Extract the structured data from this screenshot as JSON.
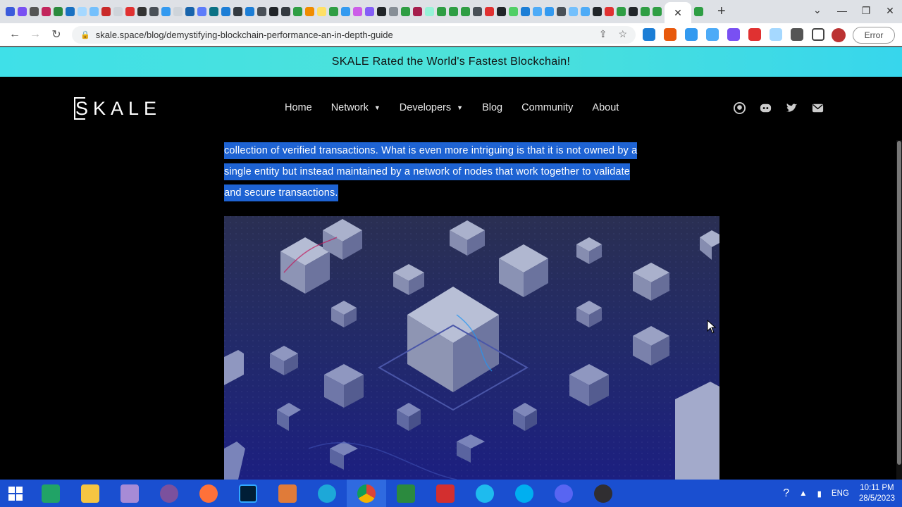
{
  "browser": {
    "url": "skale.space/blog/demystifying-blockchain-performance-an-in-depth-guide",
    "error_label": "Error",
    "active_tab_close": "✕",
    "new_tab": "+",
    "tab_menu": "⌄",
    "window_controls": [
      "—",
      "❐",
      "✕"
    ]
  },
  "announcement": "SKALE Rated the World's Fastest Blockchain!",
  "header": {
    "logo": "SKALE",
    "nav": [
      {
        "label": "Home",
        "has_dropdown": false
      },
      {
        "label": "Network",
        "has_dropdown": true
      },
      {
        "label": "Developers",
        "has_dropdown": true
      },
      {
        "label": "Blog",
        "has_dropdown": false
      },
      {
        "label": "Community",
        "has_dropdown": false
      },
      {
        "label": "About",
        "has_dropdown": false
      }
    ],
    "social_icons": [
      "github-icon",
      "discord-icon",
      "twitter-icon",
      "email-icon"
    ]
  },
  "article": {
    "lines": [
      "collection of verified transactions. What is even more intriguing is that it is not owned by a",
      "single entity but instead maintained by a network of nodes that work together to validate",
      "and secure transactions."
    ]
  },
  "taskbar": {
    "tray_language": "ENG",
    "time": "10:11 PM",
    "date": "28/5/2023"
  },
  "colors": {
    "announcement_bg": "#3fe0e8",
    "selection": "#1e63d3",
    "taskbar": "#1a4fd0"
  }
}
